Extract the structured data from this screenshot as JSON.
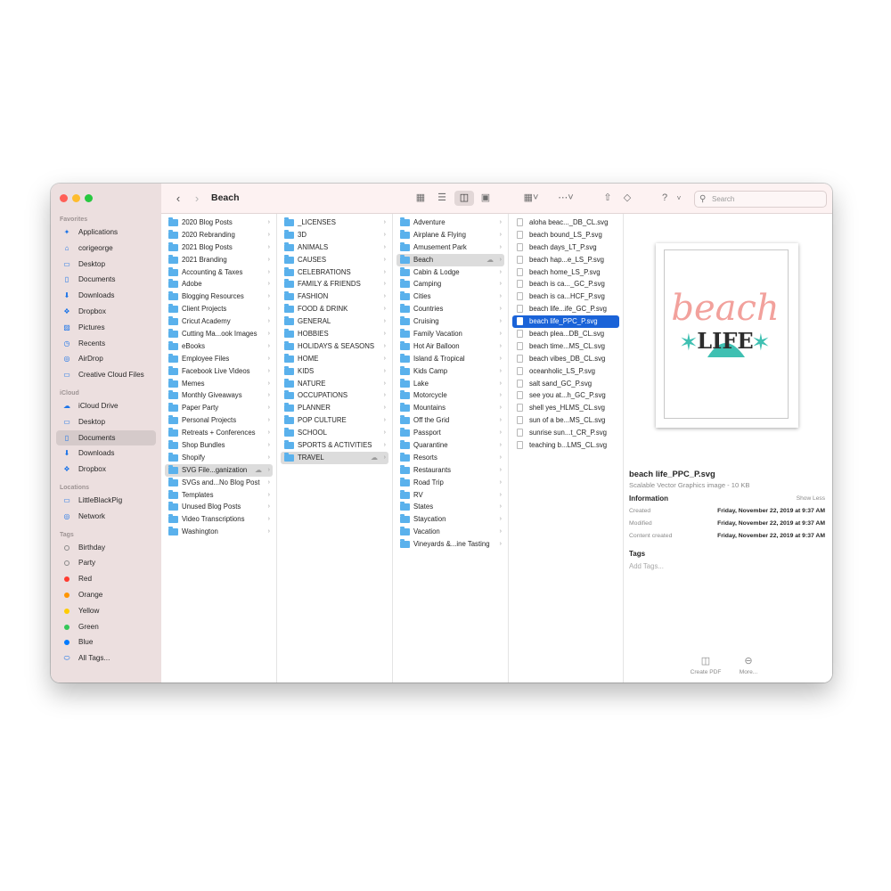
{
  "window": {
    "title": "Beach"
  },
  "toolbar": {
    "back_icon": "chevron-left-icon",
    "forward_icon": "chevron-right-icon",
    "search_placeholder": "Search"
  },
  "sidebar": {
    "sections": [
      {
        "title": "Favorites",
        "items": [
          {
            "label": "Applications",
            "icon": "applications-icon"
          },
          {
            "label": "corigeorge",
            "icon": "home-icon"
          },
          {
            "label": "Desktop",
            "icon": "desktop-icon"
          },
          {
            "label": "Documents",
            "icon": "document-icon"
          },
          {
            "label": "Downloads",
            "icon": "downloads-icon"
          },
          {
            "label": "Dropbox",
            "icon": "dropbox-icon"
          },
          {
            "label": "Pictures",
            "icon": "pictures-icon"
          },
          {
            "label": "Recents",
            "icon": "clock-icon"
          },
          {
            "label": "AirDrop",
            "icon": "airdrop-icon"
          },
          {
            "label": "Creative Cloud Files",
            "icon": "folder-icon"
          }
        ]
      },
      {
        "title": "iCloud",
        "items": [
          {
            "label": "iCloud Drive",
            "icon": "cloud-icon"
          },
          {
            "label": "Desktop",
            "icon": "desktop-icon"
          },
          {
            "label": "Documents",
            "icon": "document-icon",
            "selected": true
          },
          {
            "label": "Downloads",
            "icon": "downloads-icon"
          },
          {
            "label": "Dropbox",
            "icon": "dropbox-icon"
          }
        ]
      },
      {
        "title": "Locations",
        "items": [
          {
            "label": "LittleBlackPig",
            "icon": "computer-icon"
          },
          {
            "label": "Network",
            "icon": "network-icon"
          }
        ]
      },
      {
        "title": "Tags",
        "items": [
          {
            "label": "Birthday",
            "tag_color": ""
          },
          {
            "label": "Party",
            "tag_color": ""
          },
          {
            "label": "Red",
            "tag_color": "#ff3b30"
          },
          {
            "label": "Orange",
            "tag_color": "#ff9500"
          },
          {
            "label": "Yellow",
            "tag_color": "#ffcc00"
          },
          {
            "label": "Green",
            "tag_color": "#34c759"
          },
          {
            "label": "Blue",
            "tag_color": "#007aff"
          },
          {
            "label": "All Tags...",
            "icon": "all-tags-icon"
          }
        ]
      }
    ]
  },
  "columns": [
    {
      "items": [
        {
          "label": "2020 Blog Posts"
        },
        {
          "label": "2020 Rebranding"
        },
        {
          "label": "2021 Blog Posts"
        },
        {
          "label": "2021 Branding"
        },
        {
          "label": "Accounting & Taxes"
        },
        {
          "label": "Adobe"
        },
        {
          "label": "Blogging Resources"
        },
        {
          "label": "Client Projects"
        },
        {
          "label": "Cricut Academy"
        },
        {
          "label": "Cutting Ma...ook Images"
        },
        {
          "label": "eBooks"
        },
        {
          "label": "Employee Files"
        },
        {
          "label": "Facebook Live Videos"
        },
        {
          "label": "Memes"
        },
        {
          "label": "Monthly Giveaways"
        },
        {
          "label": "Paper Party"
        },
        {
          "label": "Personal Projects"
        },
        {
          "label": "Retreats + Conferences"
        },
        {
          "label": "Shop Bundles"
        },
        {
          "label": "Shopify"
        },
        {
          "label": "SVG File...ganization",
          "selected": true,
          "cloud": true
        },
        {
          "label": "SVGs and...No Blog Post"
        },
        {
          "label": "Templates"
        },
        {
          "label": "Unused Blog Posts"
        },
        {
          "label": "Video Transcriptions"
        },
        {
          "label": "Washington"
        }
      ]
    },
    {
      "items": [
        {
          "label": "_LICENSES"
        },
        {
          "label": "3D"
        },
        {
          "label": "ANIMALS"
        },
        {
          "label": "CAUSES"
        },
        {
          "label": "CELEBRATIONS"
        },
        {
          "label": "FAMILY & FRIENDS"
        },
        {
          "label": "FASHION"
        },
        {
          "label": "FOOD & DRINK"
        },
        {
          "label": "GENERAL"
        },
        {
          "label": "HOBBIES"
        },
        {
          "label": "HOLIDAYS & SEASONS"
        },
        {
          "label": "HOME"
        },
        {
          "label": "KIDS"
        },
        {
          "label": "NATURE"
        },
        {
          "label": "OCCUPATIONS"
        },
        {
          "label": "PLANNER"
        },
        {
          "label": "POP CULTURE"
        },
        {
          "label": "SCHOOL"
        },
        {
          "label": "SPORTS & ACTIVITIES"
        },
        {
          "label": "TRAVEL",
          "selected": true,
          "cloud": true
        }
      ]
    },
    {
      "items": [
        {
          "label": "Adventure"
        },
        {
          "label": "Airplane & Flying"
        },
        {
          "label": "Amusement Park"
        },
        {
          "label": "Beach",
          "selected": true,
          "cloud": true
        },
        {
          "label": "Cabin & Lodge"
        },
        {
          "label": "Camping"
        },
        {
          "label": "Cities"
        },
        {
          "label": "Countries"
        },
        {
          "label": "Cruising"
        },
        {
          "label": "Family Vacation"
        },
        {
          "label": "Hot Air Balloon"
        },
        {
          "label": "Island & Tropical"
        },
        {
          "label": "Kids Camp"
        },
        {
          "label": "Lake"
        },
        {
          "label": "Motorcycle"
        },
        {
          "label": "Mountains"
        },
        {
          "label": "Off the Grid"
        },
        {
          "label": "Passport"
        },
        {
          "label": "Quarantine"
        },
        {
          "label": "Resorts"
        },
        {
          "label": "Restaurants"
        },
        {
          "label": "Road Trip"
        },
        {
          "label": "RV"
        },
        {
          "label": "States"
        },
        {
          "label": "Staycation"
        },
        {
          "label": "Vacation"
        },
        {
          "label": "Vineyards &...ine Tasting"
        }
      ]
    },
    {
      "files": true,
      "items": [
        {
          "label": "aloha beac..._DB_CL.svg"
        },
        {
          "label": "beach bound_LS_P.svg"
        },
        {
          "label": "beach days_LT_P.svg"
        },
        {
          "label": "beach hap...e_LS_P.svg"
        },
        {
          "label": "beach home_LS_P.svg"
        },
        {
          "label": "beach is ca..._GC_P.svg"
        },
        {
          "label": "beach is ca...HCF_P.svg"
        },
        {
          "label": "beach life...ife_GC_P.svg"
        },
        {
          "label": "beach life_PPC_P.svg",
          "selected": true
        },
        {
          "label": "beach plea...DB_CL.svg"
        },
        {
          "label": "beach time...MS_CL.svg"
        },
        {
          "label": "beach vibes_DB_CL.svg"
        },
        {
          "label": "oceanholic_LS_P.svg"
        },
        {
          "label": "salt sand_GC_P.svg"
        },
        {
          "label": "see you at...h_GC_P.svg"
        },
        {
          "label": "shell yes_HLMS_CL.svg"
        },
        {
          "label": "sun of a be...MS_CL.svg"
        },
        {
          "label": "sunrise sun...t_CR_P.svg"
        },
        {
          "label": "teaching b...LMS_CL.svg"
        }
      ]
    }
  ],
  "preview": {
    "artwork": {
      "script_word": "beach",
      "block_word": "LIFE",
      "colors": {
        "script": "#f2a19c",
        "accent": "#3fc0b2",
        "text": "#2d2d2d"
      }
    },
    "file_name": "beach life_PPC_P.svg",
    "file_type": "Scalable Vector Graphics image - 10 KB",
    "info_heading": "Information",
    "show_less": "Show Less",
    "metadata": [
      {
        "key": "Created",
        "value": "Friday, November 22, 2019 at 9:37 AM"
      },
      {
        "key": "Modified",
        "value": "Friday, November 22, 2019 at 9:37 AM"
      },
      {
        "key": "Content created",
        "value": "Friday, November 22, 2019 at 9:37 AM"
      }
    ],
    "tags_heading": "Tags",
    "tags_placeholder": "Add Tags...",
    "actions": [
      {
        "label": "Create PDF",
        "icon": "create-pdf-icon"
      },
      {
        "label": "More...",
        "icon": "more-icon"
      }
    ]
  },
  "colors": {
    "selection_blue": "#1a63d8",
    "folder_blue": "#5ab1ec",
    "sidebar_bg": "#ecdfdf"
  }
}
